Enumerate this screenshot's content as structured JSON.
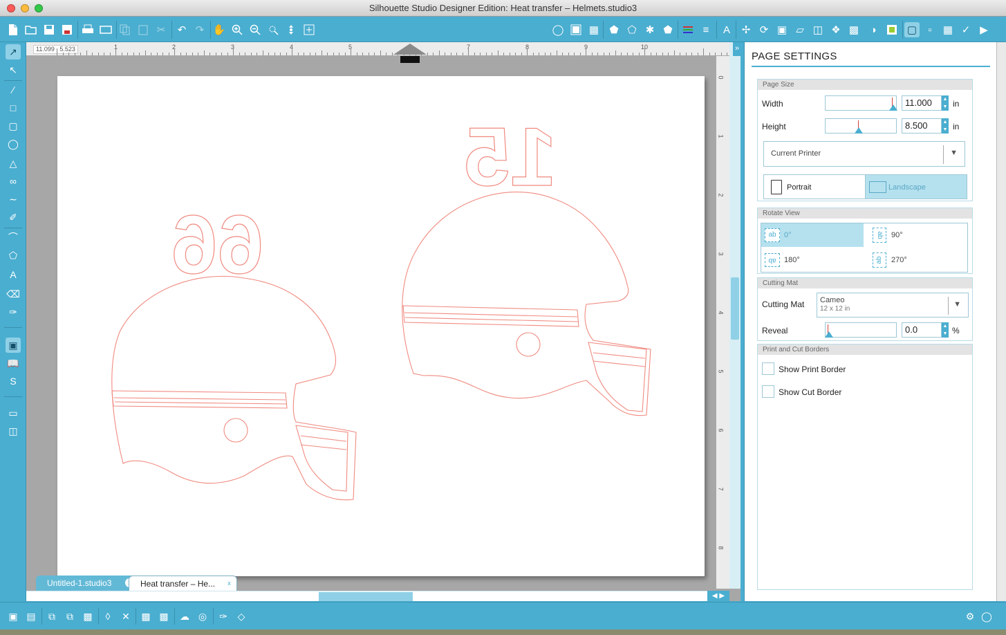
{
  "window": {
    "title": "Silhouette Studio Designer Edition: Heat transfer – Helmets.studio3"
  },
  "toolbar": {
    "icons": [
      "new-document-icon",
      "open-icon",
      "save-icon",
      "save-library-icon",
      "print-icon",
      "print-cut-icon",
      "copy-icon",
      "paste-icon",
      "cut-icon",
      "undo-icon",
      "redo-icon",
      "pan-icon",
      "zoom-in-icon",
      "zoom-out-icon",
      "zoom-select-icon",
      "zoom-drag-icon",
      "fit-to-page-icon"
    ]
  },
  "canvas": {
    "coords": "11.099 , 5.523",
    "ruler_numbers": [
      "1",
      "2",
      "3",
      "4",
      "5",
      "6",
      "7",
      "8",
      "9",
      "10"
    ],
    "ruler_right_numbers": [
      "0",
      "1",
      "2",
      "3",
      "4",
      "5",
      "6",
      "7",
      "8"
    ],
    "line_color": "#f08a80"
  },
  "tabs": [
    {
      "label": "Untitled-1.studio3",
      "close": "x"
    },
    {
      "label": "Heat transfer – He...",
      "close": "x"
    }
  ],
  "panel": {
    "title": "PAGE SETTINGS",
    "page_size": {
      "header": "Page Size",
      "width_label": "Width",
      "width_value": "11.000",
      "height_label": "Height",
      "height_value": "8.500",
      "unit": "in",
      "printer": "Current Printer",
      "portrait": "Portrait",
      "landscape": "Landscape"
    },
    "rotate_view": {
      "header": "Rotate View",
      "r0": "0°",
      "r90": "90°",
      "r180": "180°",
      "r270": "270°",
      "icon_text": "ab"
    },
    "cutting_mat": {
      "header": "Cutting Mat",
      "label": "Cutting Mat",
      "value_name": "Cameo",
      "value_size": "12 x 12 in",
      "reveal_label": "Reveal",
      "reveal_value": "0.0",
      "reveal_unit": "%"
    },
    "borders": {
      "header": "Print and Cut Borders",
      "print_border": "Show Print Border",
      "cut_border": "Show Cut Border"
    }
  },
  "design": {
    "numbers": [
      "66",
      "15"
    ]
  },
  "colors": {
    "accent": "#4aaed0",
    "selected": "#b5e1ef"
  }
}
